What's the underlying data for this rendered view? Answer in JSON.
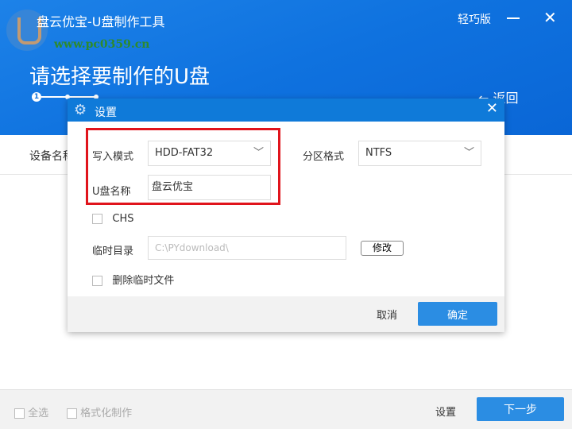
{
  "app": {
    "title": "盘云优宝-U盘制作工具",
    "edition": "轻巧版",
    "watermark": "www.pc0359.cn",
    "minimize": "—",
    "close": "✕"
  },
  "page": {
    "title": "请选择要制作的U盘",
    "step": "1",
    "back": "← 返回",
    "column_device": "设备名称"
  },
  "bottom": {
    "select_all": "全选",
    "format_make": "格式化制作",
    "settings": "设置",
    "next": "下一步"
  },
  "dialog": {
    "title": "设置",
    "gear": "⚙",
    "close": "✕",
    "write_mode_label": "写入模式",
    "write_mode_value": "HDD-FAT32",
    "partition_label": "分区格式",
    "partition_value": "NTFS",
    "name_label": "U盘名称",
    "name_value": "盘云优宝",
    "chs_label": "CHS",
    "temp_dir_label": "临时目录",
    "temp_dir_value": "C:\\PYdownload\\",
    "modify": "修改",
    "delete_temp_label": "删除临时文件",
    "cancel": "取消",
    "ok": "确定",
    "chevron": "﹀"
  }
}
